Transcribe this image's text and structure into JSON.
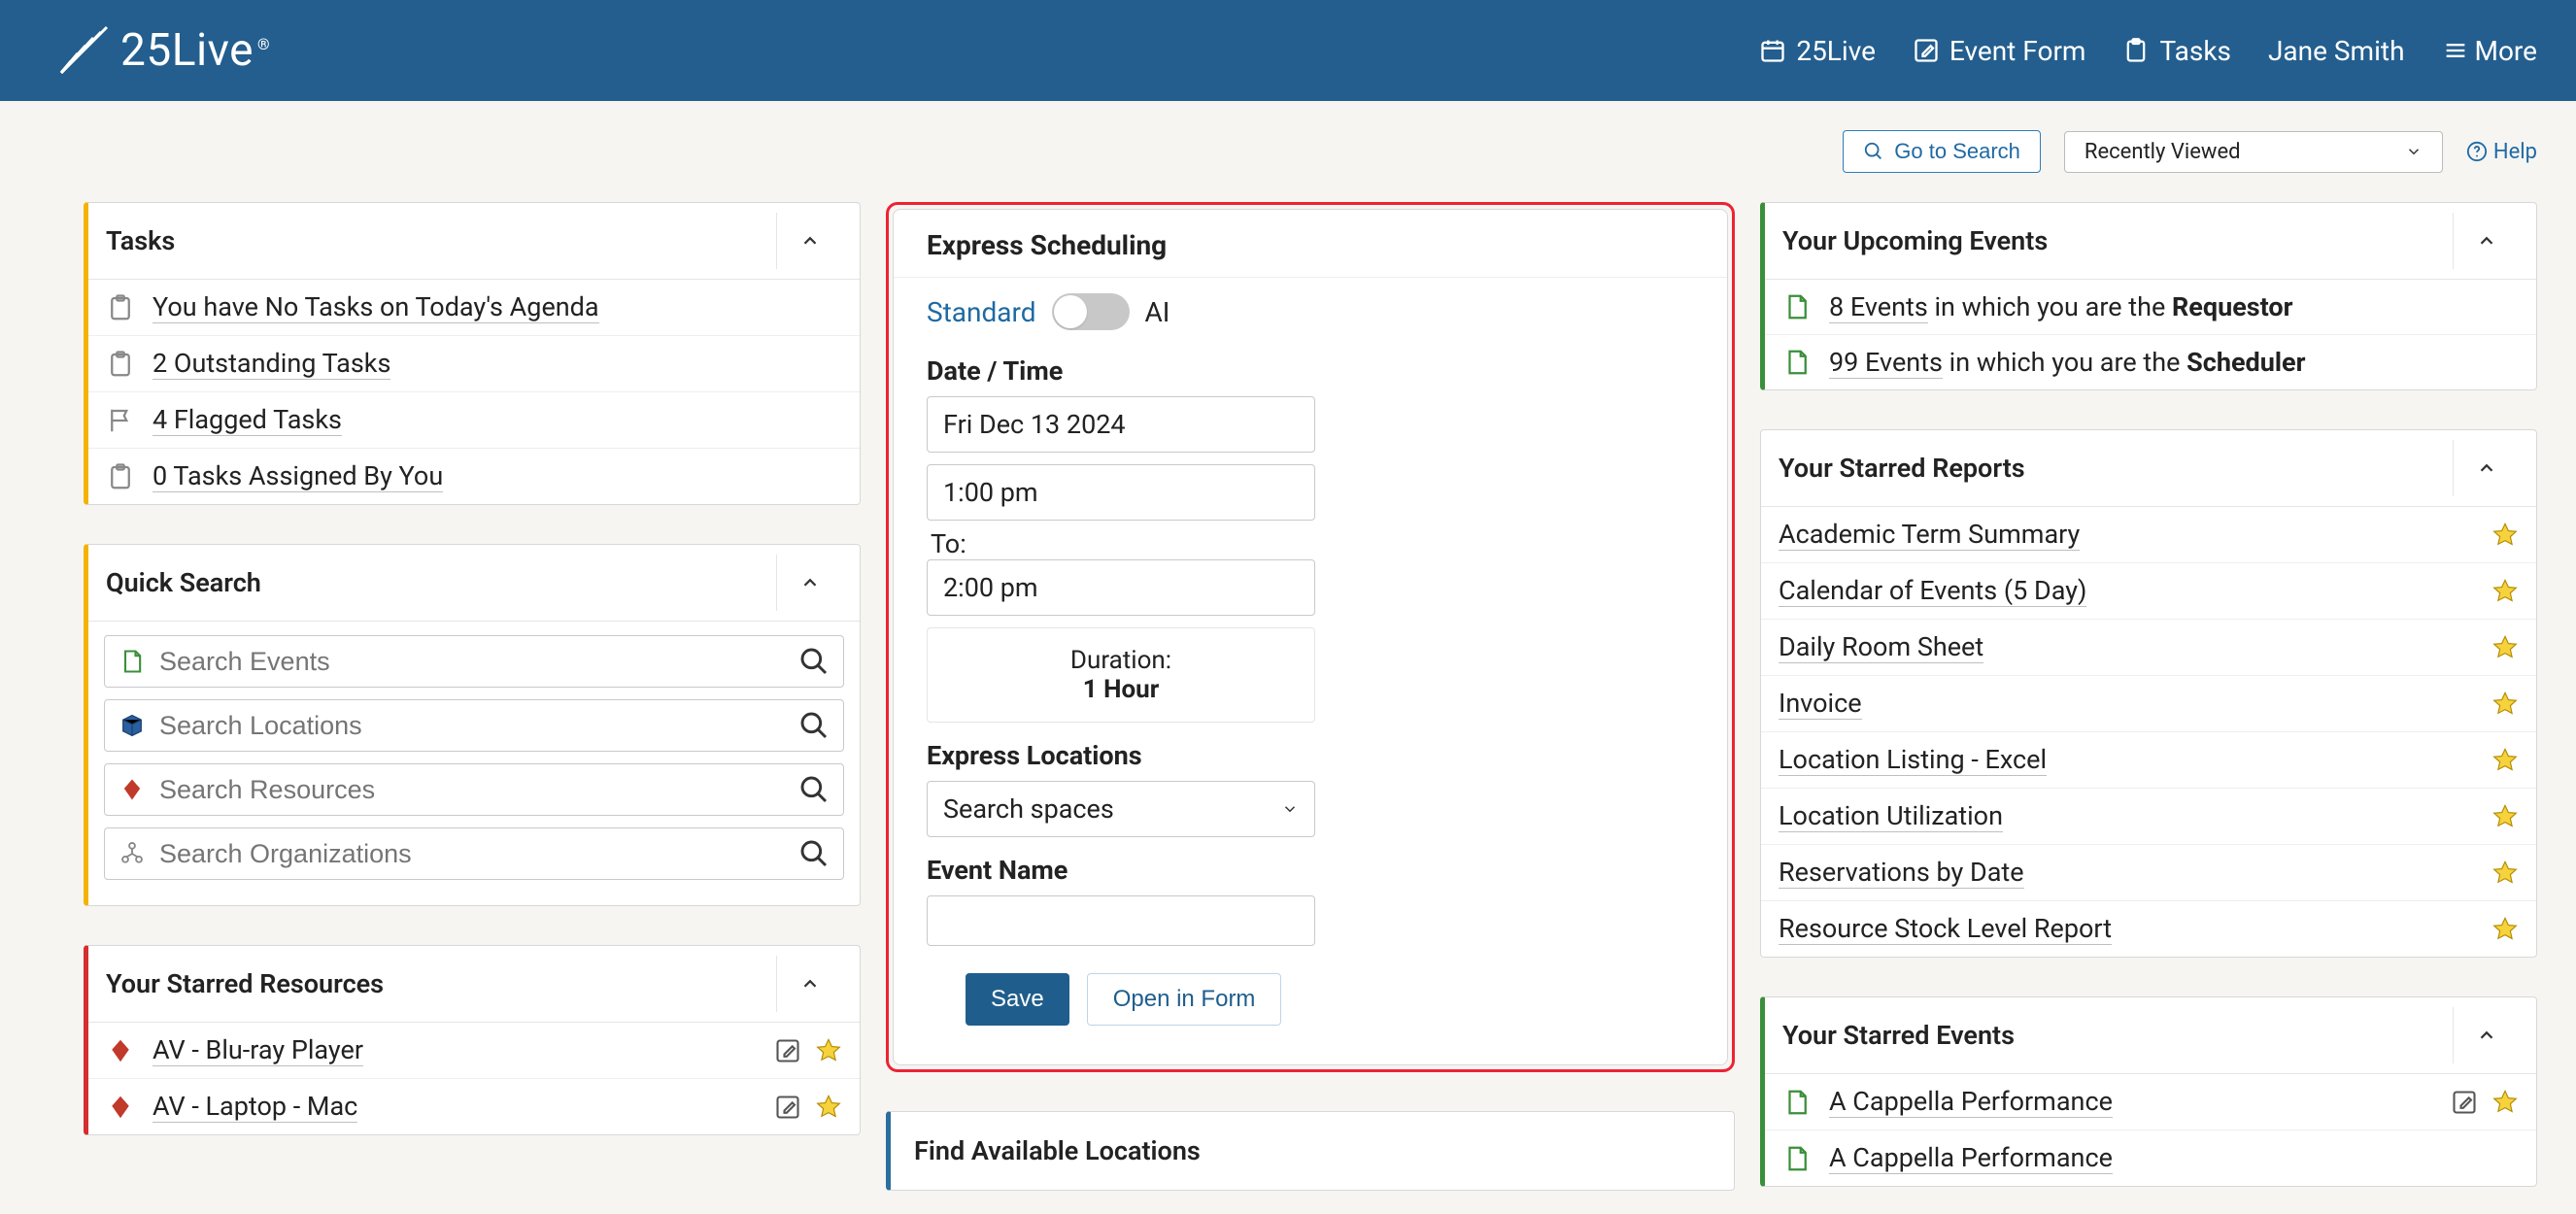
{
  "header": {
    "product": "25Live",
    "nav_25live": "25Live",
    "nav_eventform": "Event Form",
    "nav_tasks": "Tasks",
    "nav_user": "Jane Smith",
    "nav_more": "More"
  },
  "controls": {
    "goto_search": "Go to Search",
    "recently_viewed": "Recently Viewed",
    "help": "Help"
  },
  "tasks": {
    "title": "Tasks",
    "items": [
      "You have No Tasks on Today's Agenda",
      "2 Outstanding Tasks",
      "4 Flagged Tasks",
      "0 Tasks Assigned By You"
    ]
  },
  "quicksearch": {
    "title": "Quick Search",
    "placeholders": {
      "events": "Search Events",
      "locations": "Search Locations",
      "resources": "Search Resources",
      "orgs": "Search Organizations"
    }
  },
  "starred_resources": {
    "title": "Your Starred Resources",
    "items": [
      "AV - Blu-ray Player",
      "AV - Laptop - Mac"
    ]
  },
  "express": {
    "title": "Express Scheduling",
    "mode_std": "Standard",
    "mode_ai": "AI",
    "datetime_label": "Date / Time",
    "date": "Fri Dec 13 2024",
    "start": "1:00 pm",
    "to": "To:",
    "end": "2:00 pm",
    "duration_label": "Duration:",
    "duration_value": "1 Hour",
    "locations_label": "Express Locations",
    "locations_select": "Search spaces",
    "event_name_label": "Event Name",
    "save": "Save",
    "open": "Open in Form"
  },
  "find_available": {
    "title": "Find Available Locations"
  },
  "upcoming": {
    "title": "Your Upcoming Events",
    "line1_link": "8 Events",
    "line1_mid": " in which you are the ",
    "line1_bold": "Requestor",
    "line2_link": "99 Events",
    "line2_mid": " in which you are the ",
    "line2_bold": "Scheduler"
  },
  "starred_reports": {
    "title": "Your Starred Reports",
    "items": [
      "Academic Term Summary",
      "Calendar of Events (5 Day)",
      "Daily Room Sheet",
      "Invoice",
      "Location Listing - Excel",
      "Location Utilization",
      "Reservations by Date",
      "Resource Stock Level Report"
    ]
  },
  "starred_events": {
    "title": "Your Starred Events",
    "items": [
      "A Cappella Performance",
      "A Cappella Performance"
    ]
  }
}
